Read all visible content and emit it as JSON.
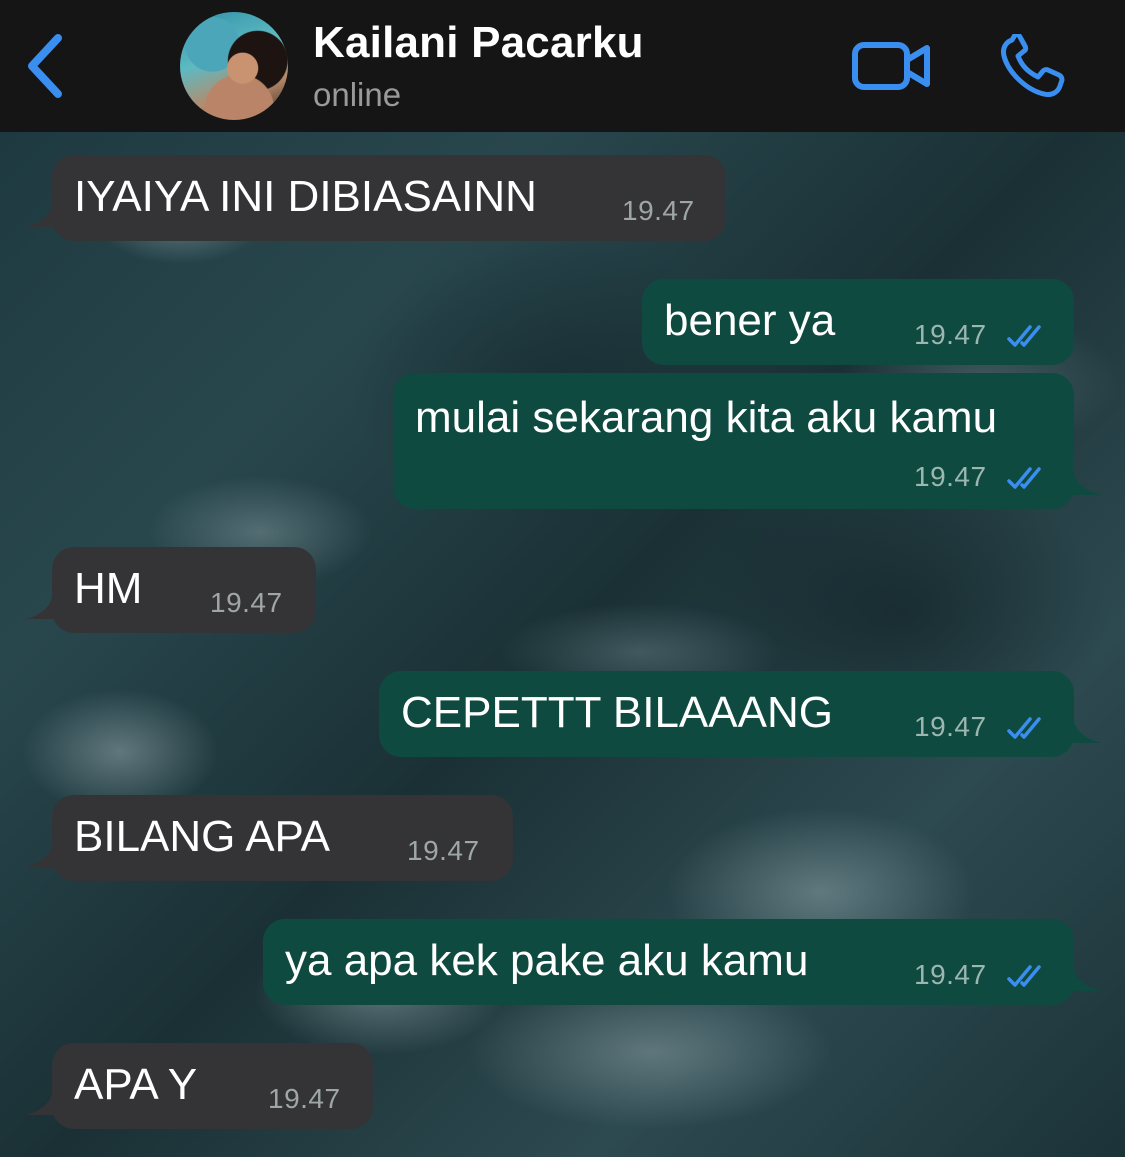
{
  "header": {
    "contact_name": "Kailani Pacarku",
    "status": "online",
    "accent_color": "#3a8ef0"
  },
  "messages": [
    {
      "direction": "incoming",
      "text": "IYAIYA INI DIBIASAINN",
      "time": "19.47"
    },
    {
      "direction": "outgoing",
      "text": "bener ya",
      "time": "19.47",
      "read": true
    },
    {
      "direction": "outgoing",
      "text": "mulai sekarang kita aku kamu",
      "time": "19.47",
      "read": true
    },
    {
      "direction": "incoming",
      "text": "HM",
      "time": "19.47"
    },
    {
      "direction": "outgoing",
      "text": "CEPETTT BILAAANG",
      "time": "19.47",
      "read": true
    },
    {
      "direction": "incoming",
      "text": "BILANG APA",
      "time": "19.47"
    },
    {
      "direction": "outgoing",
      "text": "ya apa kek pake aku kamu",
      "time": "19.47",
      "read": true
    },
    {
      "direction": "incoming",
      "text": "APA Y",
      "time": "19.47"
    }
  ],
  "colors": {
    "incoming_bubble": "#343436",
    "outgoing_bubble": "#0f4a40",
    "read_ticks": "#3a8ef0"
  },
  "icons": [
    "chevron-left-icon",
    "video-camera-icon",
    "phone-icon",
    "double-check-icon"
  ]
}
